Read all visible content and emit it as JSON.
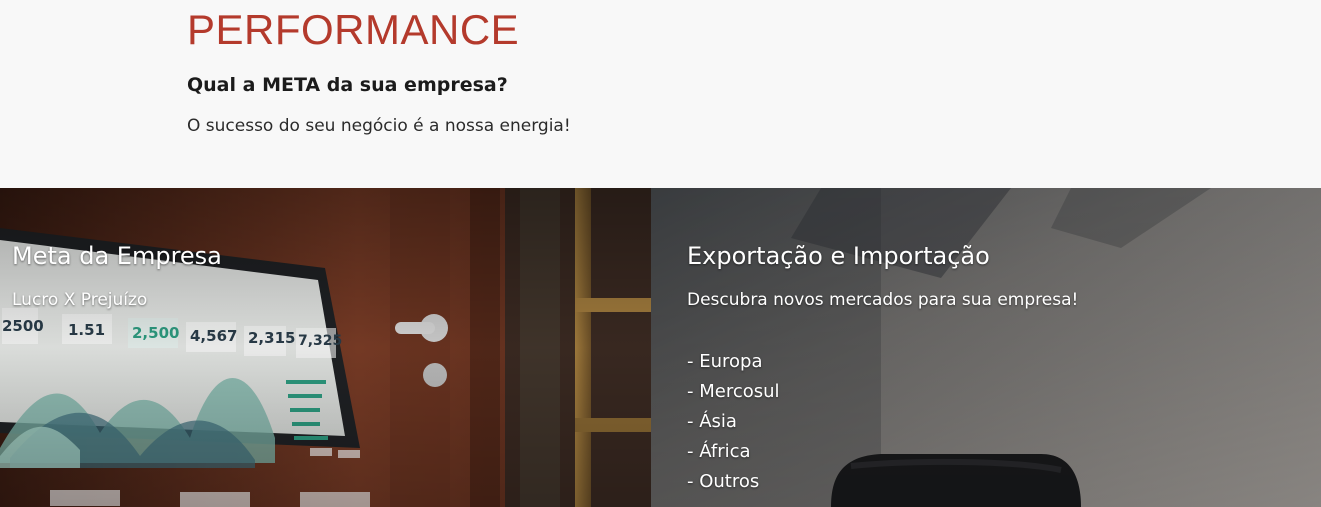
{
  "header": {
    "title": "PERFORMANCE",
    "subtitle": "Qual a META da sua empresa?",
    "tagline": "O sucesso do seu negócio é a nossa energia!"
  },
  "panels": {
    "left": {
      "title": "Meta da Empresa",
      "subtitle": "Lucro X Prejuízo",
      "dashboard_stats": [
        "2500",
        "1.51",
        "2,500",
        "4,567",
        "2,315",
        "7,325"
      ]
    },
    "right": {
      "title": "Exportação e Importação",
      "subtitle": "Descubra novos mercados para sua empresa!",
      "markets": [
        "- Europa",
        "- Mercosul",
        "- Ásia",
        "- África",
        "- Outros"
      ]
    }
  },
  "colors": {
    "accent": "#b43a2c",
    "background": "#f8f8f8",
    "text": "#1b1b1b"
  }
}
